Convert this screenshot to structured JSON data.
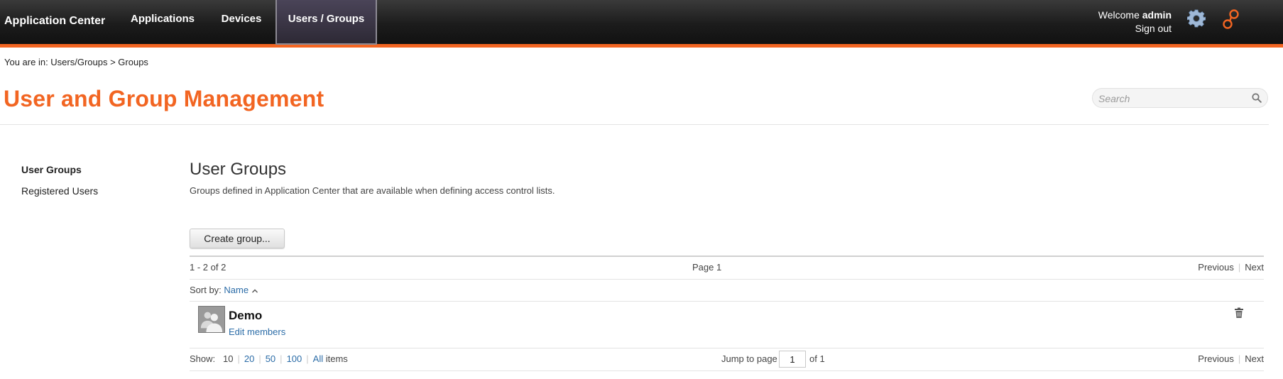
{
  "app": {
    "title": "Application Center"
  },
  "nav": {
    "tabs": [
      {
        "label": "Applications"
      },
      {
        "label": "Devices"
      },
      {
        "label": "Users / Groups"
      }
    ]
  },
  "user": {
    "welcome_prefix": "Welcome",
    "name": "admin",
    "sign_out": "Sign out"
  },
  "breadcrumb": "You are in: Users/Groups > Groups",
  "page": {
    "title": "User and Group Management"
  },
  "search": {
    "placeholder": "Search"
  },
  "sidebar": {
    "items": [
      {
        "label": "User Groups"
      },
      {
        "label": "Registered Users"
      }
    ]
  },
  "section": {
    "title": "User Groups",
    "description": "Groups defined in Application Center that are available when defining access control lists.",
    "create_button": "Create group..."
  },
  "pager": {
    "range": "1 - 2 of 2",
    "page": "Page 1",
    "previous": "Previous",
    "next": "Next"
  },
  "sort": {
    "label": "Sort by:",
    "field": "Name"
  },
  "groups": [
    {
      "name": "Demo",
      "action": "Edit members"
    }
  ],
  "footer": {
    "show_label": "Show:",
    "page_sizes": [
      "10",
      "20",
      "50",
      "100",
      "All"
    ],
    "items_label": "items",
    "jump_label": "Jump to page",
    "jump_value": "1",
    "of_label": "of 1"
  },
  "colors": {
    "accent": "#f26522",
    "link": "#2b6ca7",
    "header": "#1c1c1c"
  }
}
